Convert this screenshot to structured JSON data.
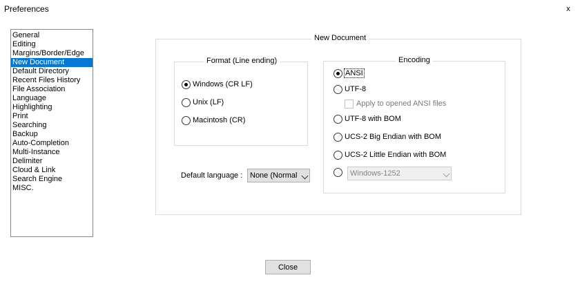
{
  "window": {
    "title": "Preferences",
    "close_glyph": "x"
  },
  "sidebar": {
    "items": [
      {
        "label": "General"
      },
      {
        "label": "Editing"
      },
      {
        "label": "Margins/Border/Edge"
      },
      {
        "label": "New Document",
        "selected": true
      },
      {
        "label": "Default Directory"
      },
      {
        "label": "Recent Files History"
      },
      {
        "label": "File Association"
      },
      {
        "label": "Language"
      },
      {
        "label": "Highlighting"
      },
      {
        "label": "Print"
      },
      {
        "label": "Searching"
      },
      {
        "label": "Backup"
      },
      {
        "label": "Auto-Completion"
      },
      {
        "label": "Multi-Instance"
      },
      {
        "label": "Delimiter"
      },
      {
        "label": "Cloud & Link"
      },
      {
        "label": "Search Engine"
      },
      {
        "label": "MISC."
      }
    ]
  },
  "new_document": {
    "group_title": "New Document",
    "format": {
      "group_title": "Format (Line ending)",
      "options": [
        {
          "label": "Windows (CR LF)",
          "checked": true
        },
        {
          "label": "Unix (LF)",
          "checked": false
        },
        {
          "label": "Macintosh (CR)",
          "checked": false
        }
      ]
    },
    "encoding": {
      "group_title": "Encoding",
      "options": [
        {
          "label": "ANSI",
          "checked": true
        },
        {
          "label": "UTF-8",
          "checked": false
        },
        {
          "label": "UTF-8 with BOM",
          "checked": false
        },
        {
          "label": "UCS-2 Big Endian with BOM",
          "checked": false
        },
        {
          "label": "UCS-2 Little Endian with BOM",
          "checked": false
        }
      ],
      "apply_ansi_label": "Apply to opened ANSI files",
      "codepage_value": "Windows-1252"
    },
    "default_language": {
      "label": "Default language :",
      "value": "None (Normal"
    }
  },
  "footer": {
    "close_label": "Close"
  }
}
